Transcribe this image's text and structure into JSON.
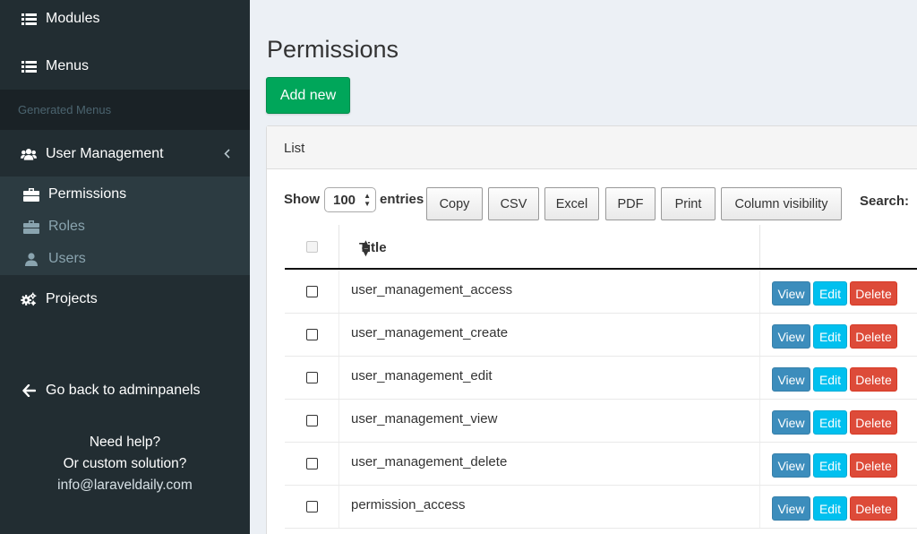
{
  "sidebar": {
    "modules_label": "Modules",
    "menus_label": "Menus",
    "header_label": "Generated Menus",
    "user_management_label": "User Management",
    "permissions_label": "Permissions",
    "roles_label": "Roles",
    "users_label": "Users",
    "projects_label": "Projects",
    "go_back_label": "Go back to adminpanels",
    "help_line1": "Need help?",
    "help_line2": "Or custom solution?",
    "help_email": "info@laraveldaily.com",
    "colors": {
      "background": "#222d32",
      "header_bg": "#1a2226",
      "submenu_bg": "#2c3b41"
    }
  },
  "main": {
    "title": "Permissions",
    "add_button": "Add new",
    "panel_title": "List",
    "show_label": "Show",
    "entries_value": "100",
    "entries_label": "entries",
    "search_label": "Search:",
    "toolbar": {
      "copy": "Copy",
      "csv": "CSV",
      "excel": "Excel",
      "pdf": "PDF",
      "print": "Print",
      "column_visibility": "Column visibility"
    },
    "table": {
      "title_header": "Title",
      "rows": [
        {
          "title": "user_management_access",
          "view": "View",
          "edit": "Edit",
          "delete": "Delete"
        },
        {
          "title": "user_management_create",
          "view": "View",
          "edit": "Edit",
          "delete": "Delete"
        },
        {
          "title": "user_management_edit",
          "view": "View",
          "edit": "Edit",
          "delete": "Delete"
        },
        {
          "title": "user_management_view",
          "view": "View",
          "edit": "Edit",
          "delete": "Delete"
        },
        {
          "title": "user_management_delete",
          "view": "View",
          "edit": "Edit",
          "delete": "Delete"
        },
        {
          "title": "permission_access",
          "view": "View",
          "edit": "Edit",
          "delete": "Delete"
        }
      ]
    },
    "colors": {
      "add_button": "#00a65a",
      "view_button": "#3c8dbc",
      "edit_button": "#00c0ef",
      "delete_button": "#dd4b39"
    }
  }
}
